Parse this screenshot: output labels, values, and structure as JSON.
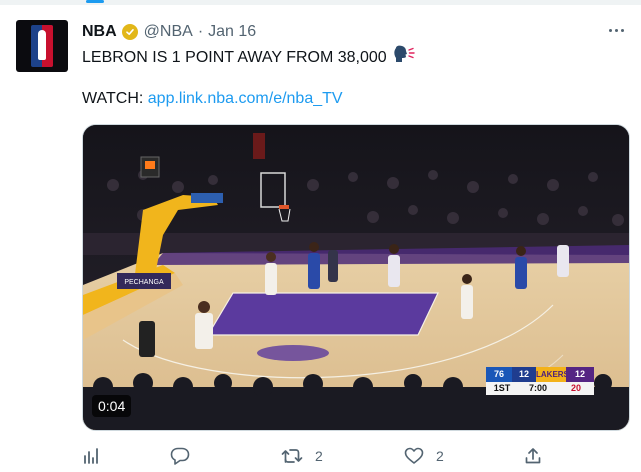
{
  "tweet": {
    "author_name": "NBA",
    "handle": "@NBA",
    "separator": "·",
    "date": "Jan 16",
    "text": "LEBRON IS 1 POINT AWAY FROM 38,000",
    "watch_label": "WATCH:",
    "link": "app.link.nba.com/e/nba_TV"
  },
  "video": {
    "duration": "0:04",
    "court_banner": "PECHANGA",
    "scoreboard": {
      "home_abbr": "76",
      "home_score": "12",
      "away_abbr": "LAKERS",
      "away_score": "12",
      "quarter": "1ST",
      "clock": "7:00",
      "shot_clock": "20"
    }
  },
  "actions": {
    "reply_count": "",
    "retweet_count": "2",
    "like_count": "2"
  },
  "icons": {
    "verified": "verified-badge-icon",
    "more": "more-icon",
    "speaker": "speaking-head-icon",
    "analytics": "analytics-icon",
    "reply": "reply-icon",
    "retweet": "retweet-icon",
    "like": "heart-icon",
    "share": "share-icon"
  },
  "colors": {
    "accent": "#1d9bf0",
    "verified_gold": "#e2b719",
    "muted": "#536471"
  }
}
